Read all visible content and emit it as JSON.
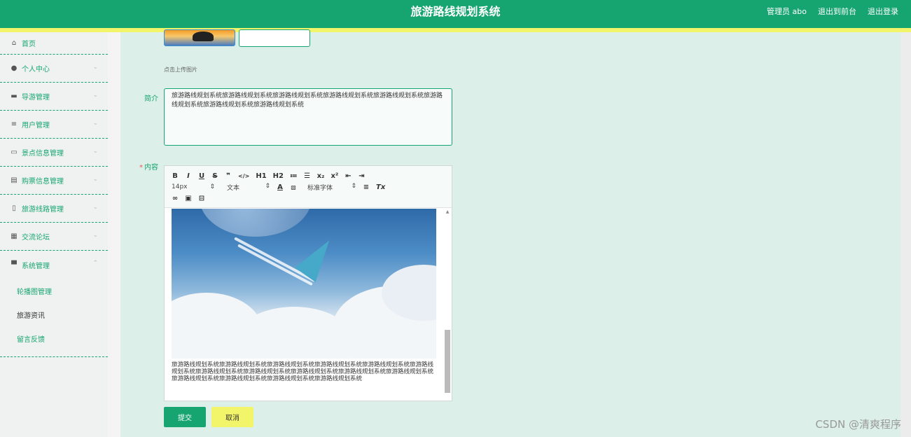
{
  "header": {
    "title": "旅游路线规划系统",
    "admin_label": "管理员 abo",
    "back_front": "退出到前台",
    "logout": "退出登录"
  },
  "sidebar": {
    "items": [
      {
        "label": "首页",
        "icon": "home-icon"
      },
      {
        "label": "个人中心",
        "icon": "user-icon"
      },
      {
        "label": "导游管理",
        "icon": "briefcase-icon"
      },
      {
        "label": "用户管理",
        "icon": "list-icon"
      },
      {
        "label": "景点信息管理",
        "icon": "chat-icon"
      },
      {
        "label": "购票信息管理",
        "icon": "ticket-icon"
      },
      {
        "label": "旅游线路管理",
        "icon": "phone-icon"
      },
      {
        "label": "交流论坛",
        "icon": "grid-icon"
      },
      {
        "label": "系统管理",
        "icon": "system-icon"
      }
    ],
    "sub_items": [
      {
        "label": "轮播图管理"
      },
      {
        "label": "旅游资讯"
      },
      {
        "label": "留言反馈"
      }
    ]
  },
  "form": {
    "upload_hint": "点击上传图片",
    "intro_label": "简介",
    "intro_value": "旅游路线规划系统旅游路线规划系统旅游路线规划系统旅游路线规划系统旅游路线规划系统旅游路线规划系统旅游路线规划系统旅游路线规划系统",
    "content_label": "内容",
    "content_required": "*",
    "content_text": "旅游路线规划系统旅游路线规划系统旅游路线规划系统旅游路线规划系统旅游路线规划系统旅游路线规划系统旅游路线规划系统旅游路线规划系统旅游路线规划系统旅游路线规划系统旅游路线规划系统旅游路线规划系统旅游路线规划系统旅游路线规划系统旅游路线规划系统",
    "submit_label": "提交",
    "cancel_label": "取消"
  },
  "toolbar": {
    "row1": [
      "B",
      "I",
      "U",
      "S",
      "❞",
      "</>",
      "H1",
      "H2",
      "≔",
      "☰",
      "x₂",
      "x²",
      "⇤",
      "⇥"
    ],
    "font_size": "14px",
    "text_style": "文本",
    "font_family": "标准字体",
    "clear_format": "Tx"
  },
  "watermark": "CSDN @清爽程序"
}
